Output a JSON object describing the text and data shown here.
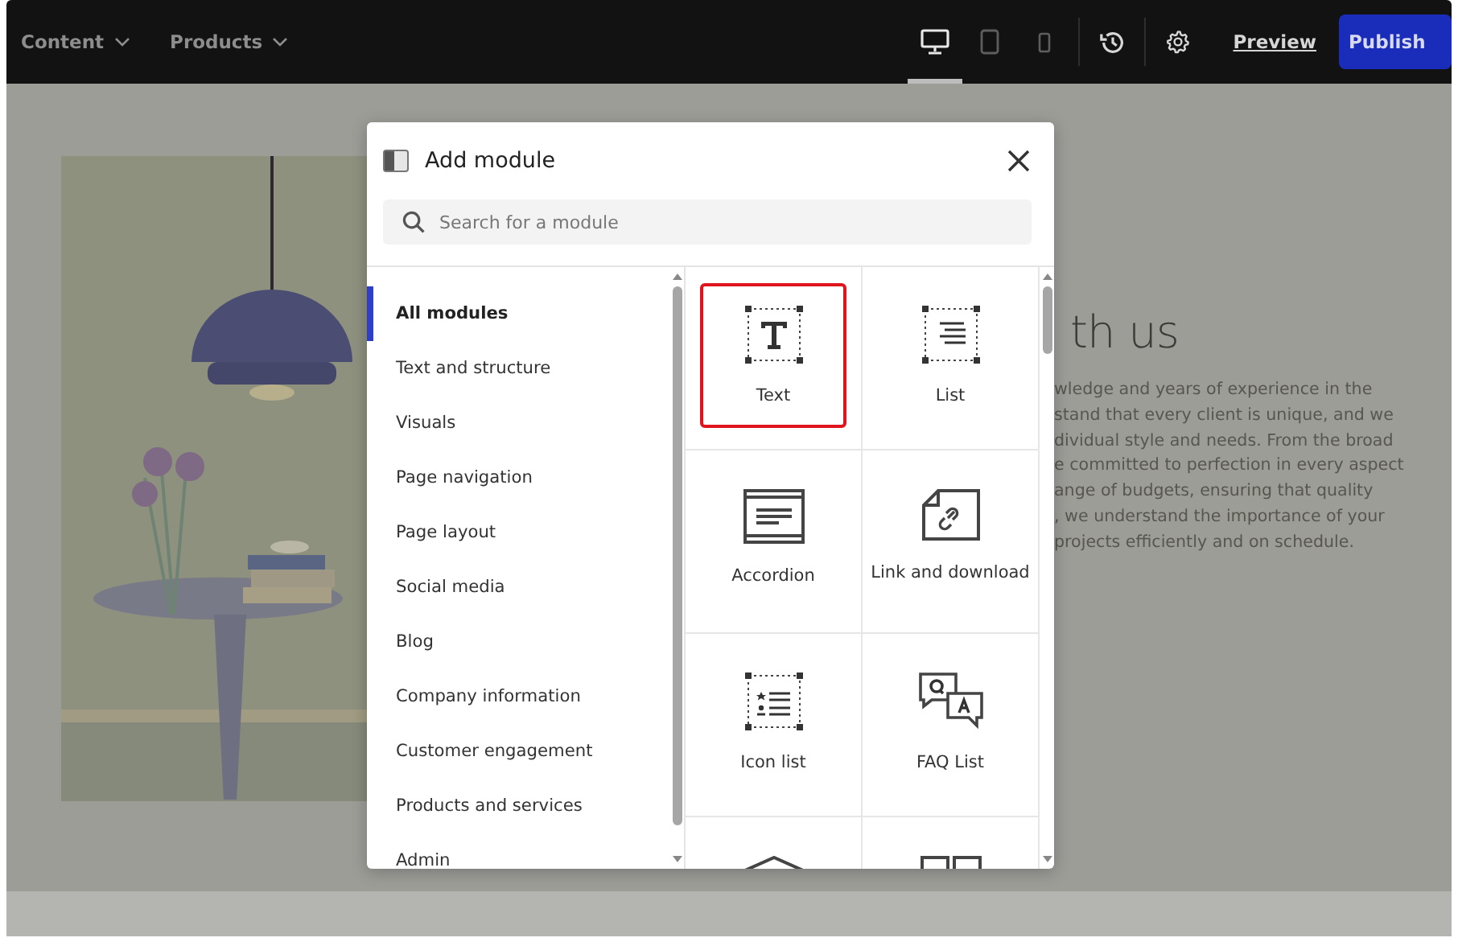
{
  "topbar": {
    "menus": [
      {
        "label": "Content"
      },
      {
        "label": "Products"
      }
    ],
    "devices": [
      {
        "kind": "desktop",
        "selected": true
      },
      {
        "kind": "tablet",
        "selected": false
      },
      {
        "kind": "phone",
        "selected": false
      }
    ],
    "preview": "Preview",
    "publish": "Publish"
  },
  "page": {
    "picture": {
      "kind": "picture"
    },
    "heading": "th us",
    "lines": [
      "wledge and years of experience in the",
      "stand that every client is unique, and we",
      "dividual style and needs. From the broad",
      "e committed to perfection in every aspect",
      "ange of budgets, ensuring that quality",
      ", we understand the importance of your",
      "projects efficiently and on schedule."
    ]
  },
  "modal": {
    "title": "Add module",
    "search": {
      "placeholder": "Search for a module"
    },
    "categories": [
      {
        "label": "All modules",
        "selected": true
      },
      {
        "label": "Text and structure",
        "selected": false
      },
      {
        "label": "Visuals",
        "selected": false
      },
      {
        "label": "Page navigation",
        "selected": false
      },
      {
        "label": "Page layout",
        "selected": false
      },
      {
        "label": "Social media",
        "selected": false
      },
      {
        "label": "Blog",
        "selected": false
      },
      {
        "label": "Company information",
        "selected": false
      },
      {
        "label": "Customer engagement",
        "selected": false
      },
      {
        "label": "Products and services",
        "selected": false
      },
      {
        "label": "Admin",
        "selected": false
      }
    ],
    "modules": [
      {
        "kind": "text",
        "label": "Text",
        "selected": true
      },
      {
        "kind": "list",
        "label": "List",
        "selected": false
      },
      {
        "kind": "accordion",
        "label": "Accordion",
        "selected": false
      },
      {
        "kind": "link",
        "label": "Link and download",
        "selected": false
      },
      {
        "kind": "iconlist",
        "label": "Icon list",
        "selected": false
      },
      {
        "kind": "faq",
        "label": "FAQ List",
        "selected": false
      },
      {
        "kind": "roof",
        "selected": false
      },
      {
        "kind": "columns",
        "selected": false
      }
    ]
  }
}
